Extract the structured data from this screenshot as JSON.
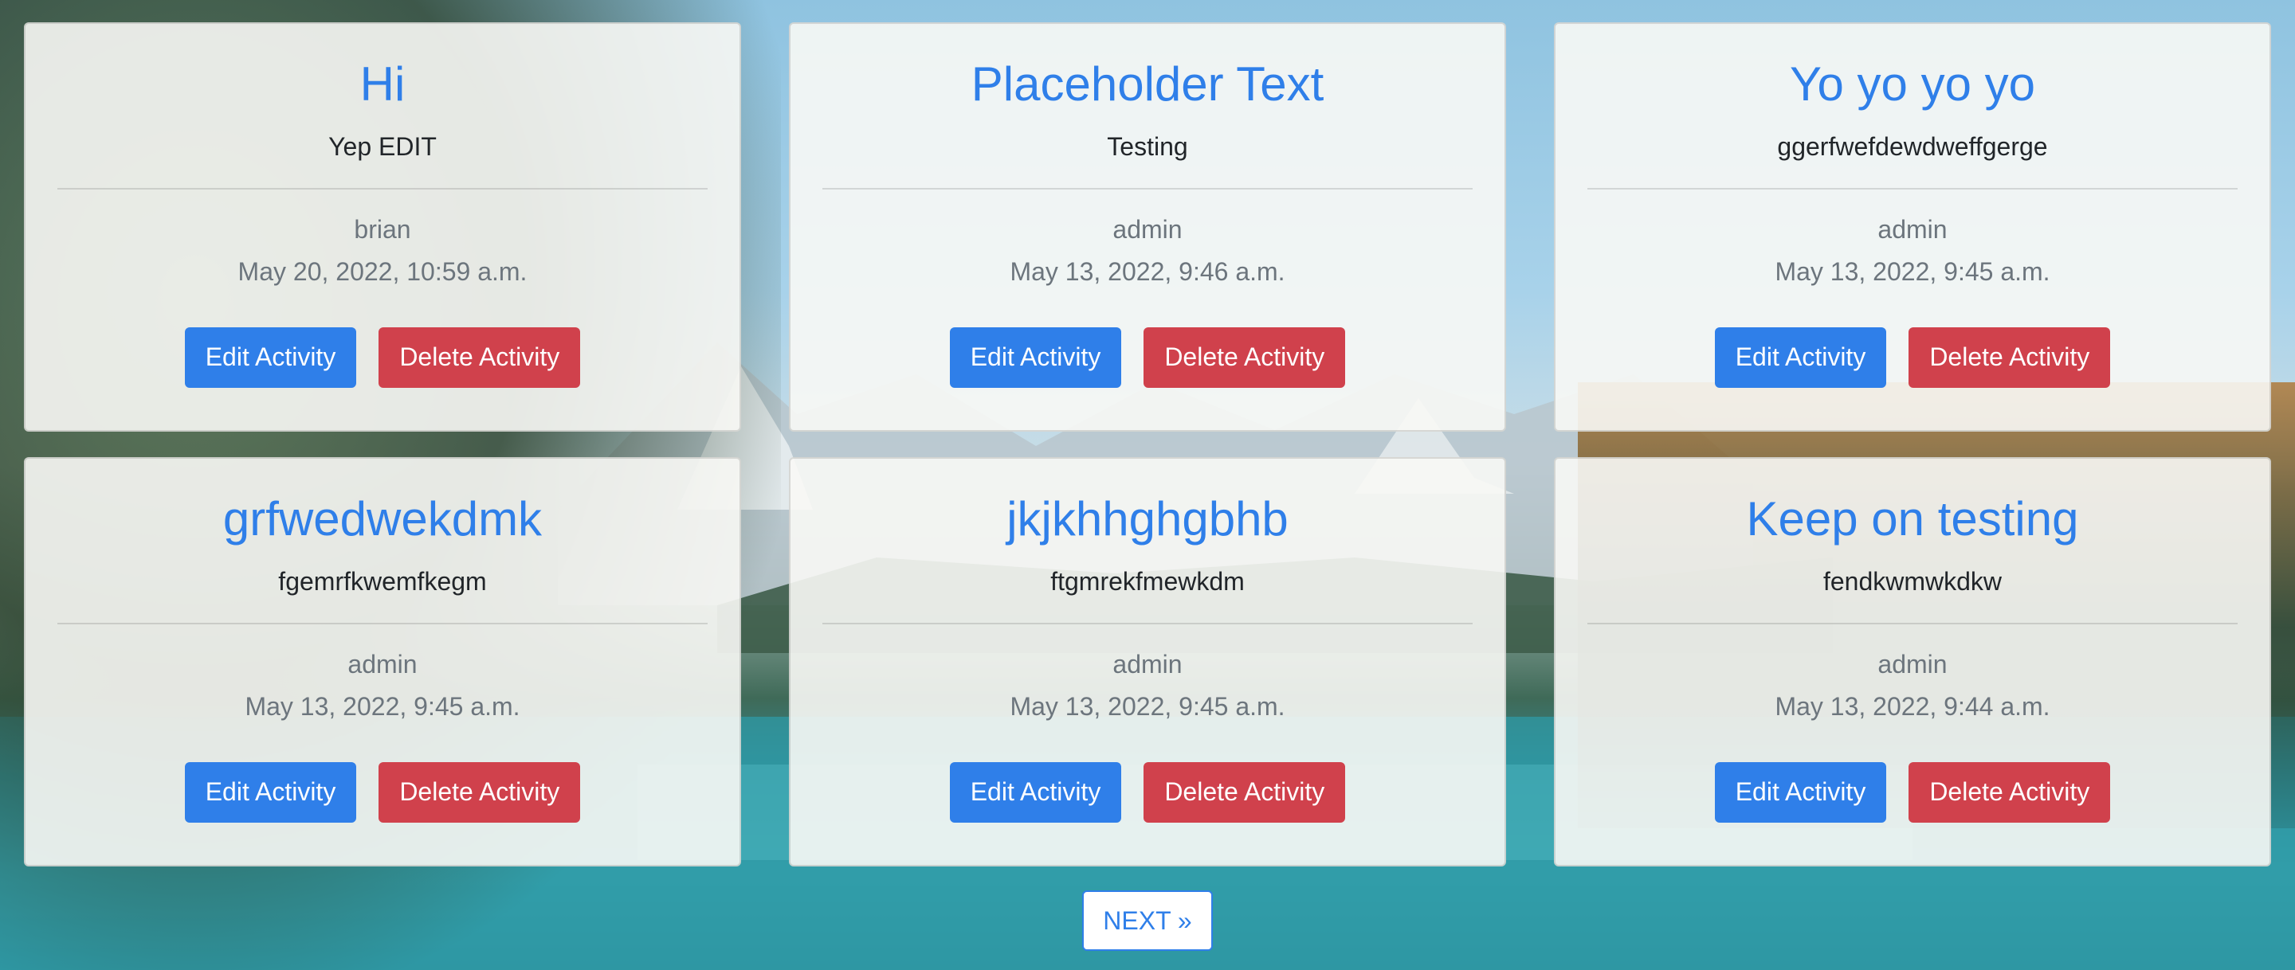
{
  "background": {
    "description_colors": {
      "sky": "#8fc3e0",
      "lake": "#39a9b5",
      "forest": "#2c4330"
    }
  },
  "colors": {
    "primary": "#2f7fe9",
    "danger": "#d0414c",
    "muted": "#6c757d",
    "text": "#212529"
  },
  "activities": [
    {
      "title": "Hi",
      "description": "Yep EDIT",
      "author": "brian",
      "date": "May 20, 2022, 10:59 a.m.",
      "edit_label": "Edit Activity",
      "delete_label": "Delete Activity"
    },
    {
      "title": "Placeholder Text",
      "description": "Testing",
      "author": "admin",
      "date": "May 13, 2022, 9:46 a.m.",
      "edit_label": "Edit Activity",
      "delete_label": "Delete Activity"
    },
    {
      "title": "Yo yo yo yo",
      "description": "ggerfwefdewdweffgerge",
      "author": "admin",
      "date": "May 13, 2022, 9:45 a.m.",
      "edit_label": "Edit Activity",
      "delete_label": "Delete Activity"
    },
    {
      "title": "grfwedwekdmk",
      "description": "fgemrfkwemfkegm",
      "author": "admin",
      "date": "May 13, 2022, 9:45 a.m.",
      "edit_label": "Edit Activity",
      "delete_label": "Delete Activity"
    },
    {
      "title": "jkjkhhghgbhb",
      "description": "ftgmrekfmewkdm",
      "author": "admin",
      "date": "May 13, 2022, 9:45 a.m.",
      "edit_label": "Edit Activity",
      "delete_label": "Delete Activity"
    },
    {
      "title": "Keep on testing",
      "description": "fendkwmwkdkw",
      "author": "admin",
      "date": "May 13, 2022, 9:44 a.m.",
      "edit_label": "Edit Activity",
      "delete_label": "Delete Activity"
    }
  ],
  "pagination": {
    "next_label": "NEXT »"
  }
}
